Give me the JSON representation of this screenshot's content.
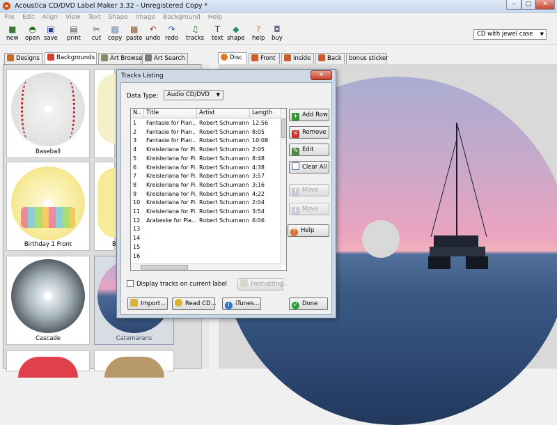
{
  "window": {
    "title": "Acoustica CD/DVD Label Maker 3.32 - Unregistered Copy *",
    "controls": [
      "–",
      "□",
      "✕"
    ]
  },
  "menu": [
    "File",
    "Edit",
    "Align",
    "View",
    "Text",
    "Shape",
    "Image",
    "Background",
    "Help"
  ],
  "toolbar": [
    {
      "label": "new",
      "icon": "new-icon",
      "glyph": "■",
      "color": "#3a7a3a"
    },
    {
      "label": "open",
      "icon": "open-icon",
      "glyph": "◓",
      "color": "#2a7a2a"
    },
    {
      "label": "save",
      "icon": "save-icon",
      "glyph": "▣",
      "color": "#2a3a8a"
    },
    {
      "label": "print",
      "icon": "print-icon",
      "glyph": "▤",
      "color": "#444444"
    },
    {
      "label": "cut",
      "icon": "cut-icon",
      "glyph": "✂",
      "color": "#555555"
    },
    {
      "label": "copy",
      "icon": "copy-icon",
      "glyph": "▨",
      "color": "#3a6a9a"
    },
    {
      "label": "paste",
      "icon": "paste-icon",
      "glyph": "▩",
      "color": "#8a5a2a"
    },
    {
      "label": "undo",
      "icon": "undo-icon",
      "glyph": "↶",
      "color": "#c03020"
    },
    {
      "label": "redo",
      "icon": "redo-icon",
      "glyph": "↷",
      "color": "#2050b0"
    },
    {
      "label": "tracks",
      "icon": "tracks-icon",
      "glyph": "♫",
      "color": "#2a8a2a"
    },
    {
      "label": "text",
      "icon": "text-icon",
      "glyph": "T",
      "color": "#333333"
    },
    {
      "label": "shape",
      "icon": "shape-icon",
      "glyph": "◆",
      "color": "#2a8a5a"
    },
    {
      "label": "help",
      "icon": "help-icon",
      "glyph": "?",
      "color": "#c08a1a"
    },
    {
      "label": "buy",
      "icon": "buy-icon",
      "glyph": "◘",
      "color": "#6a6a8a"
    }
  ],
  "case_select": {
    "value": "CD with jewel case"
  },
  "left_tabs": [
    "Designs",
    "Backgrounds",
    "Art Browse",
    "Art Search"
  ],
  "right_tabs": [
    "Disc",
    "Front",
    "Inside",
    "Back",
    "bonus sticker"
  ],
  "thumbnails": [
    "Baseball",
    "Birthday 1 Front",
    "Cascade",
    "Catamarans"
  ],
  "thumb_partial_labels": [
    "B"
  ],
  "dialog": {
    "title": "Tracks Listing",
    "close": "✕",
    "data_type_label": "Data Type:",
    "data_type_value": "Audio CD/DVD",
    "columns": [
      "N..",
      "Title",
      "Artist",
      "Length"
    ],
    "rows": [
      {
        "n": "1",
        "title": "Fantasie for Pian...",
        "artist": "Robert Schumann",
        "length": "12:56"
      },
      {
        "n": "2",
        "title": "Fantasie for Pian...",
        "artist": "Robert Schumann",
        "length": "8:05"
      },
      {
        "n": "3",
        "title": "Fantasie for Pian...",
        "artist": "Robert Schumann",
        "length": "10:08"
      },
      {
        "n": "4",
        "title": "Kreisleriana for Pi...",
        "artist": "Robert Schumann",
        "length": "2:05"
      },
      {
        "n": "5",
        "title": "Kreisleriana for Pi...",
        "artist": "Robert Schumann",
        "length": "8:48"
      },
      {
        "n": "6",
        "title": "Kreisleriana for Pi...",
        "artist": "Robert Schumann",
        "length": "4:38"
      },
      {
        "n": "7",
        "title": "Kreisleriana for Pi...",
        "artist": "Robert Schumann",
        "length": "3:57"
      },
      {
        "n": "8",
        "title": "Kreisleriana for Pi...",
        "artist": "Robert Schumann",
        "length": "3:16"
      },
      {
        "n": "9",
        "title": "Kreisleriana for Pi...",
        "artist": "Robert Schumann",
        "length": "4:22"
      },
      {
        "n": "10",
        "title": "Kreisleriana for Pi...",
        "artist": "Robert Schumann",
        "length": "2:04"
      },
      {
        "n": "11",
        "title": "Kreisleriana for Pi...",
        "artist": "Robert Schumann",
        "length": "3:54"
      },
      {
        "n": "12",
        "title": "Arabeske for Pia...",
        "artist": "Robert Schumann",
        "length": "6:06"
      },
      {
        "n": "13",
        "title": "",
        "artist": "",
        "length": ""
      },
      {
        "n": "14",
        "title": "",
        "artist": "",
        "length": ""
      },
      {
        "n": "15",
        "title": "",
        "artist": "",
        "length": ""
      },
      {
        "n": "16",
        "title": "",
        "artist": "",
        "length": ""
      }
    ],
    "buttons": {
      "add_row": "Add Row",
      "remove": "Remove",
      "edit": "Edit",
      "clear_all": "Clear All",
      "move_up": "Move",
      "move_down": "Move",
      "help": "Help",
      "import": "Import...",
      "read_cd": "Read CD...",
      "itunes": "iTunes...",
      "done": "Done",
      "formatting": "Formatting..."
    },
    "display_tracks_label": "Display tracks on current label",
    "display_tracks_checked": false
  }
}
